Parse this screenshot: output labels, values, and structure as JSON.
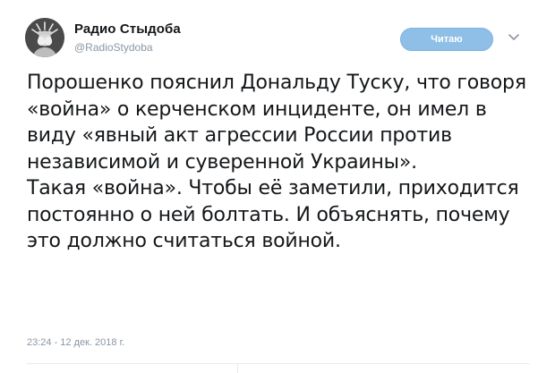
{
  "account": {
    "display_name": "Радио Стыдоба",
    "handle": "@RadioStydoba",
    "avatar_icon": "statue-avatar-icon"
  },
  "follow_button": {
    "label": "Читаю",
    "color": "#8fbfe6"
  },
  "menu_icon": "chevron-down-icon",
  "tweet": {
    "paragraph_1": "Порошенко пояснил Дональду Туску, что говоря «война» о керченском инциденте, он имел в виду «явный акт агрессии России против независимой и суверенной Украины».",
    "paragraph_2": "Такая «война». Чтобы её заметили, приходится постоянно о ней болтать. И объяснять, почему это должно считаться войной.",
    "timestamp": "23:24 - 12 дек. 2018 г."
  }
}
